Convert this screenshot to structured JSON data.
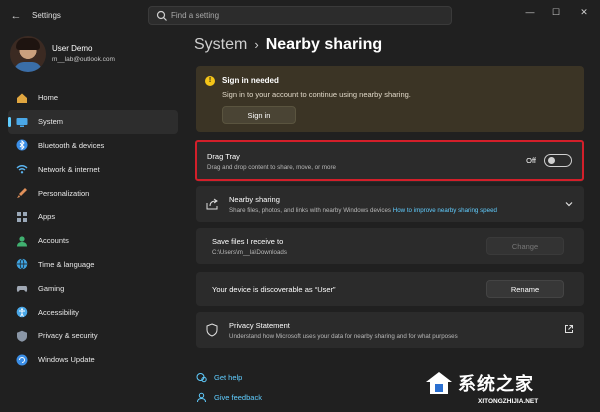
{
  "window": {
    "app_title": "Settings",
    "search_placeholder": "Find a setting",
    "controls": [
      "—",
      "☐",
      "✕"
    ]
  },
  "user": {
    "name": "User Demo",
    "email": "m__lab@outlook.com"
  },
  "sidebar": {
    "items": [
      {
        "label": "Home",
        "icon": "home-icon",
        "color": "#e0a640"
      },
      {
        "label": "System",
        "icon": "system-icon",
        "color": "#4aa8e8",
        "active": true
      },
      {
        "label": "Bluetooth & devices",
        "icon": "bluetooth-icon",
        "color": "#3b8ee6"
      },
      {
        "label": "Network & internet",
        "icon": "wifi-icon",
        "color": "#5ab4f0"
      },
      {
        "label": "Personalization",
        "icon": "brush-icon",
        "color": "#e0905a"
      },
      {
        "label": "Apps",
        "icon": "apps-icon",
        "color": "#9aa8b8"
      },
      {
        "label": "Accounts",
        "icon": "accounts-icon",
        "color": "#40b070"
      },
      {
        "label": "Time & language",
        "icon": "globe-icon",
        "color": "#3fa3e0"
      },
      {
        "label": "Gaming",
        "icon": "gaming-icon",
        "color": "#a0a8b4"
      },
      {
        "label": "Accessibility",
        "icon": "accessibility-icon",
        "color": "#4aa8e8"
      },
      {
        "label": "Privacy & security",
        "icon": "shield-icon",
        "color": "#8a96a6"
      },
      {
        "label": "Windows Update",
        "icon": "update-icon",
        "color": "#3b8ee6"
      }
    ]
  },
  "breadcrumb": {
    "parent": "System",
    "separator": "›",
    "current": "Nearby sharing"
  },
  "signin": {
    "title": "Sign in needed",
    "desc": "Sign in to your account to continue using nearby sharing.",
    "button": "Sign in"
  },
  "drag_tray": {
    "title": "Drag Tray",
    "desc": "Drag and drop content to share, move, or more",
    "state": "Off",
    "enabled": false
  },
  "nearby": {
    "title": "Nearby sharing",
    "desc": "Share files, photos, and links with nearby Windows devices",
    "link": "How to improve nearby sharing speed"
  },
  "save_files": {
    "title": "Save files I receive to",
    "path": "C:\\Users\\m__la\\Downloads",
    "button": "Change"
  },
  "discoverable": {
    "text": "Your device is discoverable as “User”",
    "button": "Rename"
  },
  "privacy": {
    "title": "Privacy Statement",
    "desc": "Understand how Microsoft uses your data for nearby sharing and for what purposes"
  },
  "help": {
    "get_help": "Get help",
    "give_feedback": "Give feedback"
  },
  "watermark": {
    "text": "系统之家",
    "url": "XITONGZHIJIA.NET"
  },
  "colors": {
    "accent": "#60cdff",
    "highlight_border": "#d31f2a",
    "warning": "#f5c518"
  }
}
